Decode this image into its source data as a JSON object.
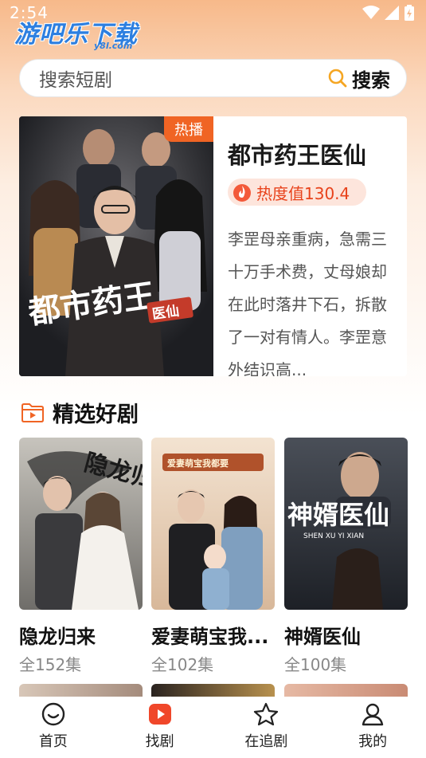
{
  "status_bar": {
    "time": "2:54"
  },
  "watermark": {
    "text": "游吧乐下载",
    "sub": "y8l.com"
  },
  "search": {
    "placeholder": "搜索短剧",
    "button_label": "搜索"
  },
  "hero": {
    "badge": "热播",
    "title": "都市药王医仙",
    "heat": "热度值130.4",
    "description": "李罡母亲重病，急需三十万手术费，丈母娘却在此时落井下石，拆散了一对有情人。李罡意外结识高...",
    "poster_title_line1": "都市药王",
    "poster_title_badge": "医仙"
  },
  "section": {
    "title": "精选好剧"
  },
  "dramas": [
    {
      "title": "隐龙归来",
      "episodes": "全152集",
      "poster_text": "隐龙归来"
    },
    {
      "title": "爱妻萌宝我...",
      "episodes": "全102集",
      "poster_text": "爱妻萌宝我都要"
    },
    {
      "title": "神婿医仙",
      "episodes": "全100集",
      "poster_text": "神婿医仙",
      "poster_sub": "SHEN XU YI XIAN"
    }
  ],
  "nav": [
    {
      "label": "首页",
      "icon": "home-icon"
    },
    {
      "label": "找剧",
      "icon": "play-icon"
    },
    {
      "label": "在追剧",
      "icon": "star-icon"
    },
    {
      "label": "我的",
      "icon": "profile-icon"
    }
  ],
  "colors": {
    "accent": "#f06424",
    "heat": "#e8421b"
  }
}
